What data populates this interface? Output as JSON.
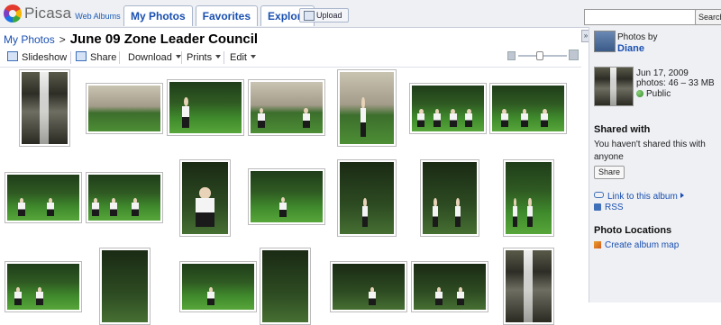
{
  "logo": {
    "text": "Picasa",
    "sub": "Web Albums"
  },
  "nav": {
    "tabs": [
      {
        "label": "My Photos"
      },
      {
        "label": "Favorites"
      },
      {
        "label": "Explore"
      }
    ],
    "upload_label": "Upload"
  },
  "search": {
    "placeholder": "",
    "button_label": "Search"
  },
  "breadcrumb": {
    "root": "My Photos",
    "separator": ">",
    "album_title": "June 09 Zone Leader Council"
  },
  "toolbar": {
    "slideshow": "Slideshow",
    "share": "Share",
    "download": "Download",
    "prints": "Prints",
    "edit": "Edit"
  },
  "sidebar": {
    "photos_by": "Photos by",
    "owner": "Diane",
    "album_date": "Jun 17, 2009",
    "album_count": "photos: 46 – 33 MB",
    "visibility": "Public",
    "shared_heading": "Shared with",
    "shared_text": "You haven't shared this with anyone",
    "share_button": "Share",
    "link_to_album": "Link to this album",
    "rss": "RSS",
    "locations_heading": "Photo Locations",
    "create_map": "Create album map"
  },
  "colors": {
    "link": "#1a4fb0",
    "chrome": "#eef0f4"
  }
}
